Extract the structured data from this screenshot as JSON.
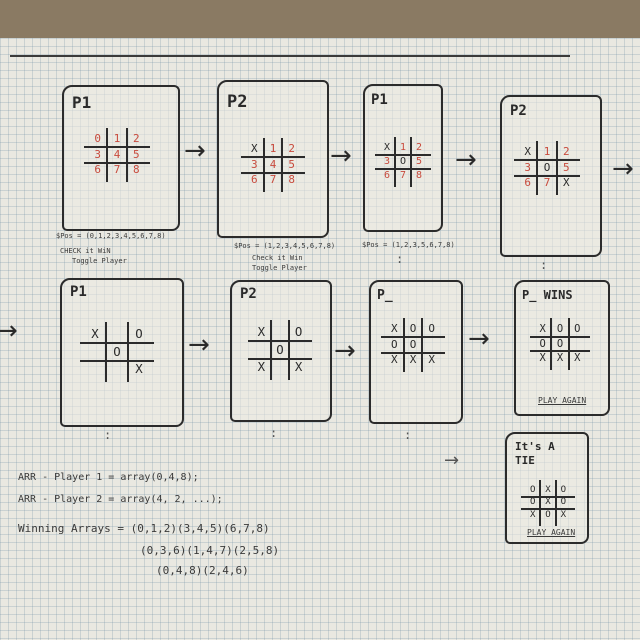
{
  "frames": [
    {
      "id": "r1c1",
      "title": "P1",
      "cells": [
        "0",
        "1",
        "2",
        "3",
        "4",
        "5",
        "6",
        "7",
        "8"
      ],
      "red": true
    },
    {
      "id": "r1c2",
      "title": "P2",
      "cells": [
        "X",
        "1",
        "2",
        "3",
        "4",
        "5",
        "6",
        "7",
        "8"
      ],
      "red": true
    },
    {
      "id": "r1c3",
      "title": "P1",
      "cells": [
        "X",
        "1",
        "2",
        "3",
        "O",
        "5",
        "6",
        "7",
        "8"
      ],
      "red": true
    },
    {
      "id": "r1c4",
      "title": "P2",
      "cells": [
        "X",
        "1",
        "2",
        "3",
        "O",
        "5",
        "6",
        "7",
        "X"
      ],
      "red": true
    },
    {
      "id": "r2c1",
      "title": "P1",
      "cells": [
        "X",
        "",
        "O",
        "",
        "O",
        "",
        "",
        "",
        "X"
      ],
      "red": false
    },
    {
      "id": "r2c2",
      "title": "P2",
      "cells": [
        "X",
        "",
        "O",
        "",
        "O",
        "",
        "X",
        "",
        "X"
      ],
      "red": false
    },
    {
      "id": "r2c3",
      "title": "P̲",
      "cells": [
        "X",
        "O",
        "O",
        "O",
        "O",
        "",
        "X",
        "X",
        "X"
      ],
      "red": false
    },
    {
      "id": "r2c4",
      "title": "P̲ WINS",
      "cells": [
        "X",
        "O",
        "O",
        "O",
        "O",
        "",
        "X",
        "X",
        "X"
      ],
      "red": false
    },
    {
      "id": "tie",
      "title": "It's A TIE",
      "cells": [
        "O",
        "X",
        "O",
        "O",
        "X",
        "O",
        "X",
        "O",
        "X"
      ],
      "red": false
    }
  ],
  "notes": {
    "r1c1": "$Pos = (0,1,2,3,4,5,6,7,8)",
    "r1c1_b": "CHECK it WiN",
    "r1c1_c": "Toggle Player",
    "r1c2": "$Pos = (1,2,3,4,5,6,7,8)",
    "r1c2_b": "Check it Win",
    "r1c2_c": "Toggle Player",
    "r1c3": "$Pos = (1,2,3,5,6,7,8)",
    "arr1": "ARR - Player 1 = array(0,4,8);",
    "arr2": "ARR - Player 2 = array(4, 2, ...);",
    "win1": "Winning Arrays = (0,1,2)(3,4,5)(6,7,8)",
    "win2": "(0,3,6)(1,4,7)(2,5,8)",
    "win3": "(0,4,8)(2,4,6)",
    "play_again_1": "PLAY AGAIN",
    "play_again_2": "PLAY AGAIN",
    "dots": ":",
    "arrow": "→"
  }
}
